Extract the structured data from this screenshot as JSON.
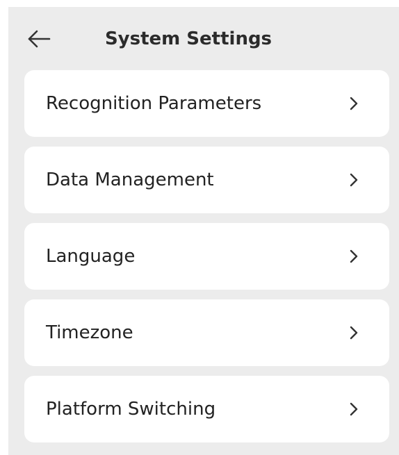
{
  "header": {
    "back_icon": "arrow-left-icon",
    "title": "System Settings"
  },
  "menu": {
    "chevron_icon": "chevron-right-icon",
    "items": [
      {
        "label": "Recognition Parameters"
      },
      {
        "label": "Data Management"
      },
      {
        "label": "Language"
      },
      {
        "label": "Timezone"
      },
      {
        "label": "Platform Switching"
      }
    ]
  },
  "colors": {
    "background": "#ececec",
    "card": "#ffffff",
    "text": "#222222"
  }
}
